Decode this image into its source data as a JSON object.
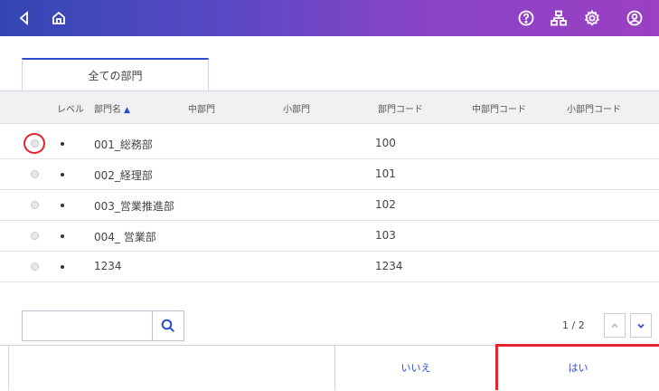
{
  "tab": {
    "label": "全ての部門"
  },
  "table": {
    "headers": {
      "level": "レベル",
      "name": "部門名",
      "sort_indicator": "▲",
      "mid": "中部門",
      "small": "小部門",
      "code": "部門コード",
      "mid_code": "中部門コード",
      "small_code": "小部門コード"
    },
    "rows": [
      {
        "name": "001_総務部",
        "code": "100"
      },
      {
        "name": "002_経理部",
        "code": "101"
      },
      {
        "name": "003_営業推進部",
        "code": "102"
      },
      {
        "name": "004_ 営業部",
        "code": "103"
      },
      {
        "name": "1234",
        "code": "1234"
      }
    ]
  },
  "search": {
    "value": ""
  },
  "pagination": {
    "text": "1 / 2"
  },
  "footer": {
    "no_label": "いいえ",
    "yes_label": "はい"
  },
  "colors": {
    "accent": "#2c4bd0",
    "highlight": "#e3242b"
  },
  "icons": [
    "back-icon",
    "home-icon",
    "help-icon",
    "org-tree-icon",
    "settings-icon",
    "account-icon",
    "search-icon",
    "chevron-up-icon",
    "chevron-down-icon"
  ]
}
